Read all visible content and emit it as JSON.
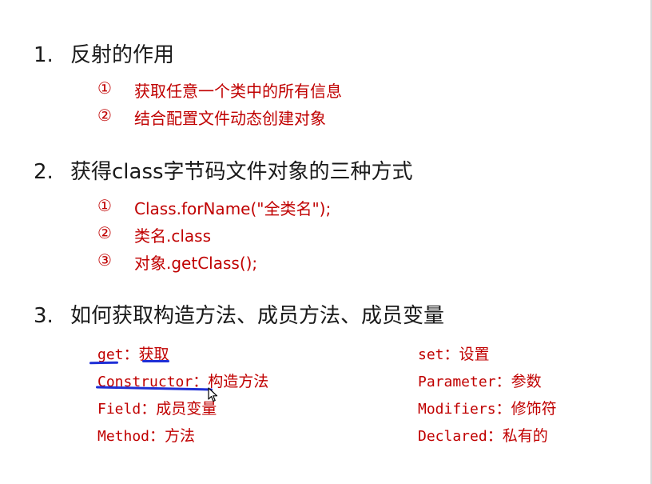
{
  "sections": [
    {
      "number": "1.",
      "title": "反射的作用",
      "items": [
        {
          "marker": "①",
          "text": "获取任意一个类中的所有信息"
        },
        {
          "marker": "②",
          "text": "结合配置文件动态创建对象"
        }
      ]
    },
    {
      "number": "2.",
      "title": "获得class字节码文件对象的三种方式",
      "items": [
        {
          "marker": "①",
          "text": "Class.forName(\"全类名\");"
        },
        {
          "marker": "②",
          "text": "类名.class"
        },
        {
          "marker": "③",
          "text": "对象.getClass();"
        }
      ]
    },
    {
      "number": "3.",
      "title": "如何获取构造方法、成员方法、成员变量",
      "left_terms": [
        {
          "key": "get",
          "sep": "：",
          "val": "获取"
        },
        {
          "key": "Constructor",
          "sep": "：",
          "val": "构造方法"
        },
        {
          "key": "Field",
          "sep": "：",
          "val": "成员变量"
        },
        {
          "key": "Method",
          "sep": "：",
          "val": "方法"
        }
      ],
      "right_terms": [
        {
          "key": "set",
          "sep": "：",
          "val": "设置"
        },
        {
          "key": "Parameter",
          "sep": "：",
          "val": "参数"
        },
        {
          "key": "Modifiers",
          "sep": "：",
          "val": "修饰符"
        },
        {
          "key": "Declared",
          "sep": "：",
          "val": "私有的"
        }
      ]
    }
  ],
  "colors": {
    "heading": "#1a1a1a",
    "accent": "#c00000",
    "annotation": "#1f2fd6"
  },
  "icons": {
    "cursor": "mouse-pointer-icon"
  }
}
